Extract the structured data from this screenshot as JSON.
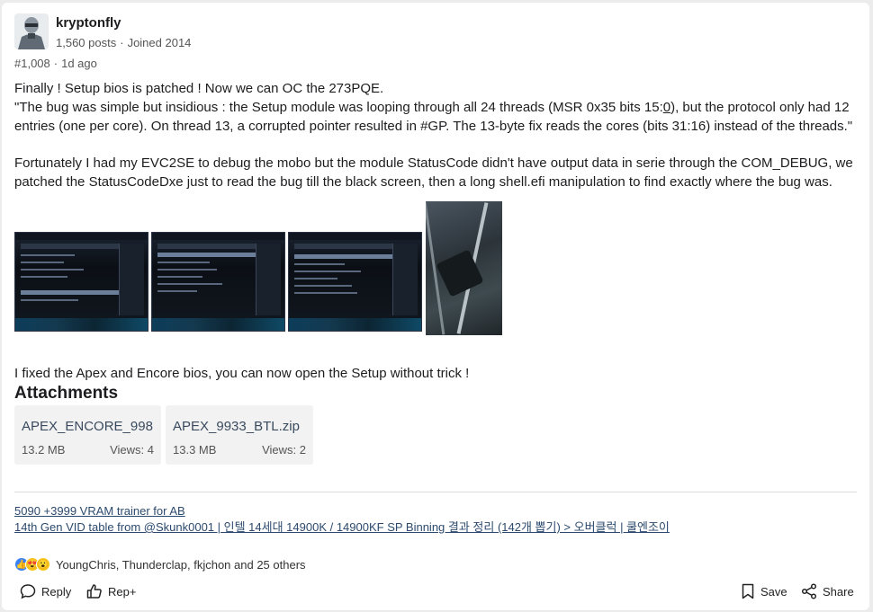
{
  "post": {
    "username": "kryptonfly",
    "posts": "1,560 posts",
    "joined": "Joined 2014",
    "post_number": "#1,008",
    "age": "1d ago",
    "body": {
      "line1": "Finally ! Setup bios is patched ! Now we can OC the 273PQE.",
      "line2_pre": "\"The bug was simple but insidious : the Setup module was looping through all 24 threads (MSR 0x35 bits 15:",
      "line2_link": "0",
      "line2_post": "), but the protocol only had 12 entries (one per core). On thread 13, a corrupted pointer resulted in #GP. The 13-byte fix reads the cores (bits 31:16) instead of the threads.\"",
      "line3": "Fortunately I had my EVC2SE to debug the mobo but the module StatusCode didn't have output data in serie through the COM_DEBUG, we patched the StatusCodeDxe just to read the bug till the black screen, then a long shell.efi manipulation to find exactly where the bug was.",
      "line4": "I fixed the Apex and Encore bios, you can now open the Setup without trick !"
    },
    "attachments_title": "Attachments",
    "attachments": [
      {
        "name": "APEX_ENCORE_998...",
        "size": "13.2 MB",
        "views": "Views: 4"
      },
      {
        "name": "APEX_9933_BTL.zip",
        "size": "13.3 MB",
        "views": "Views: 2"
      }
    ],
    "signature": {
      "line1": "5090 +3999 VRAM trainer for AB",
      "line2": "14th Gen VID table from @Skunk0001 | 인텔 14세대 14900K / 14900KF SP Binning 결과 정리 (142개 뽑기) > 오버클럭 | 쿨엔조이"
    },
    "reactions_text": "YoungChris, Thunderclap, fkjchon and 25 others",
    "actions": {
      "reply": "Reply",
      "rep": "Rep+",
      "save": "Save",
      "share": "Share"
    }
  }
}
